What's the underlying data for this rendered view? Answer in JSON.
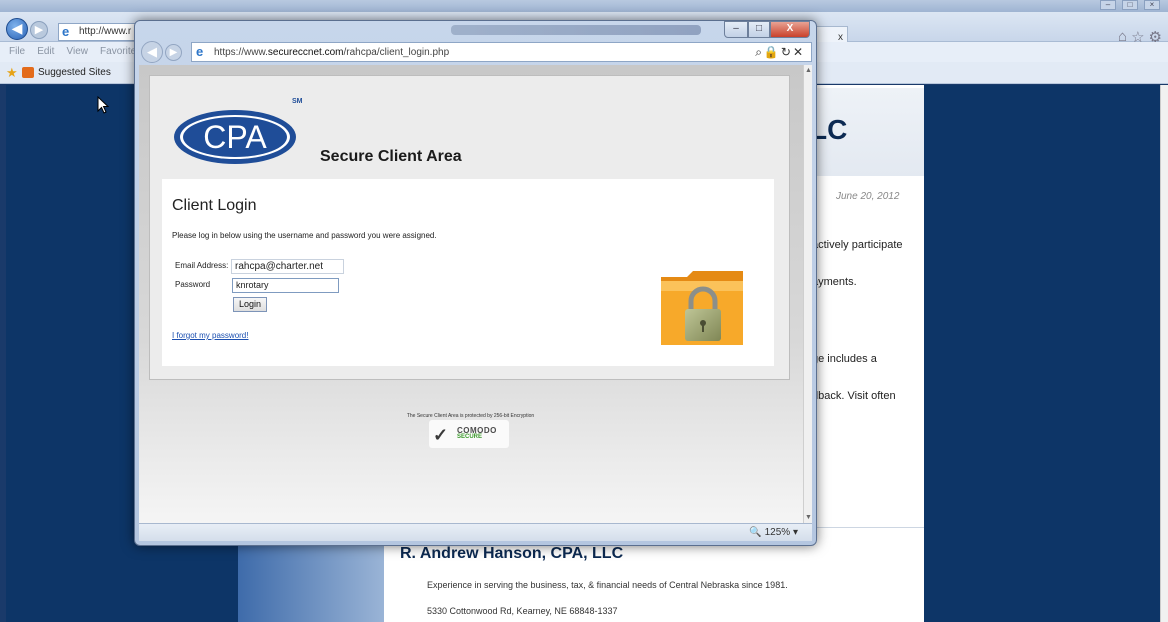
{
  "background_browser": {
    "address": "http://www.r",
    "tab_label": "x",
    "menu": [
      "File",
      "Edit",
      "View",
      "Favorites"
    ],
    "favorites": {
      "suggested_sites": "Suggested Sites"
    },
    "page": {
      "header_fragment": "LC",
      "date": "June 20, 2012",
      "fragments": [
        "actively participate",
        "ayments.",
        "ge includes a",
        "dback. Visit often"
      ],
      "footer_title": "R. Andrew Hanson, CPA, LLC",
      "footer_tagline": "Experience in serving the business, tax, & financial needs of Central Nebraska since 1981.",
      "footer_address": "5330 Cottonwood Rd, Kearney, NE  68848-1337"
    }
  },
  "popup": {
    "window_controls": {
      "close": "X"
    },
    "address": {
      "prefix": "https://www.",
      "domain": "secureccnet.com",
      "path": "/rahcpa/client_login.php"
    },
    "page": {
      "logo_text": "CPA",
      "logo_sm": "SM",
      "header_title": "Secure Client Area",
      "login_title": "Client Login",
      "instructions": "Please log in below using the username and password you were assigned.",
      "email_label": "Email Address:",
      "email_value": "rahcpa@charter.net",
      "password_label": "Password",
      "password_value": "knrotary",
      "login_button": "Login",
      "forgot_link": "I forgot my password!",
      "encryption_note": "The Secure Client Area is protected by 256-bit Encryption",
      "comodo_label": "COMODO",
      "comodo_sub": "SECURE"
    },
    "status": {
      "zoom": "125%"
    }
  }
}
